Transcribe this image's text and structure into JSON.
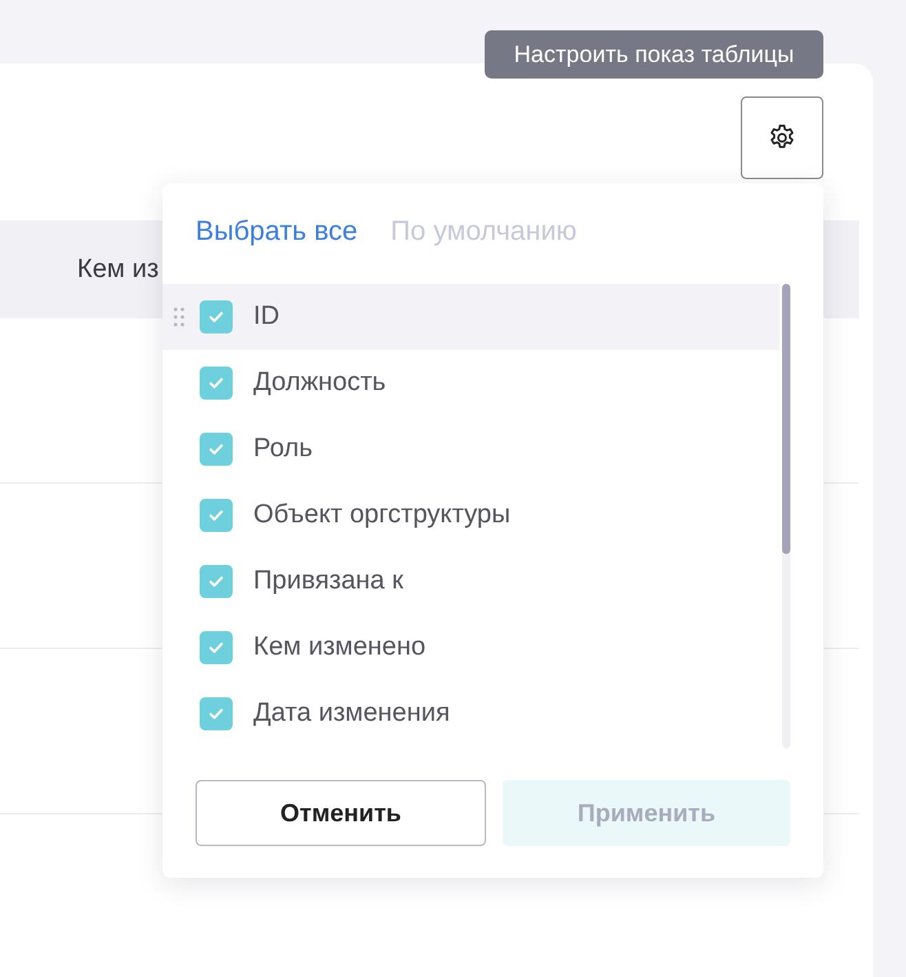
{
  "tooltip": {
    "text": "Настроить показ таблицы"
  },
  "table": {
    "columns": [
      {
        "label": "Кем из"
      }
    ]
  },
  "column_settings": {
    "select_all": {
      "label": "Выбрать все",
      "disabled": false
    },
    "reset": {
      "label": "По умолчанию",
      "disabled": true
    },
    "items": [
      {
        "label": "ID",
        "checked": true,
        "selected": true
      },
      {
        "label": "Должность",
        "checked": true,
        "selected": false
      },
      {
        "label": "Роль",
        "checked": true,
        "selected": false
      },
      {
        "label": "Объект оргструктуры",
        "checked": true,
        "selected": false
      },
      {
        "label": "Привязана к",
        "checked": true,
        "selected": false
      },
      {
        "label": "Кем изменено",
        "checked": true,
        "selected": false
      },
      {
        "label": "Дата изменения",
        "checked": true,
        "selected": false
      }
    ],
    "buttons": [
      {
        "label": "Отменить",
        "kind": "secondary",
        "disabled": false
      },
      {
        "label": "Применить",
        "kind": "primary",
        "disabled": true
      }
    ]
  }
}
